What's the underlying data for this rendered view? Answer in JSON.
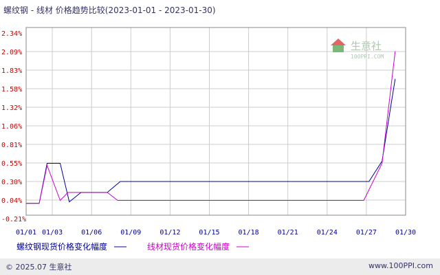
{
  "header": {
    "title": "螺纹钢 - 线材 价格趋势比较(2023-01-01 - 2023-01-30)"
  },
  "watermark": {
    "text": "生意社",
    "sub": "100PPI.COM"
  },
  "footer": {
    "copyright": "© 2025.07 生意社",
    "site": "www.100PPI.com"
  },
  "colors": {
    "series1": "#000099",
    "series2": "#cc00cc",
    "ytick": "#cc0000",
    "xtick": "#000099",
    "grid": "#cccccc"
  },
  "chart_data": {
    "type": "line",
    "title": "螺纹钢 - 线材 价格趋势比较(2023-01-01 - 2023-01-30)",
    "xlabel": "",
    "ylabel": "",
    "x_ticks": [
      "01/01",
      "01/03",
      "01/06",
      "01/09",
      "01/12",
      "01/15",
      "01/18",
      "01/21",
      "01/24",
      "01/27",
      "01/30"
    ],
    "x_tick_days": [
      1,
      3,
      6,
      9,
      12,
      15,
      18,
      21,
      24,
      27,
      30
    ],
    "y_ticks": [
      "2.34%",
      "2.09%",
      "1.83%",
      "1.58%",
      "1.32%",
      "1.06%",
      "0.81%",
      "0.55%",
      "0.30%",
      "0.04%",
      "-0.21%"
    ],
    "ylim": [
      -0.21,
      2.34
    ],
    "xlim": [
      1,
      30
    ],
    "grid": true,
    "legend_position": "bottom",
    "series": [
      {
        "name": "螺纹钢现货价格变化幅度",
        "color": "#000099",
        "points": [
          [
            1,
            0
          ],
          [
            2,
            0
          ],
          [
            2.6,
            0.55
          ],
          [
            3.6,
            0.55
          ],
          [
            4.3,
            0.02
          ],
          [
            5.2,
            0.15
          ],
          [
            7.2,
            0.15
          ],
          [
            8.2,
            0.3
          ],
          [
            27.2,
            0.3
          ],
          [
            28.2,
            0.58
          ],
          [
            29.2,
            1.71
          ]
        ]
      },
      {
        "name": "线材现货价格变化幅度",
        "color": "#cc00cc",
        "points": [
          [
            1,
            0
          ],
          [
            2,
            0
          ],
          [
            2.6,
            0.52
          ],
          [
            3.6,
            0.04
          ],
          [
            4.2,
            0.15
          ],
          [
            7.2,
            0.15
          ],
          [
            8,
            0.04
          ],
          [
            26.2,
            0.04
          ],
          [
            26.8,
            0.04
          ],
          [
            28.2,
            0.55
          ],
          [
            29.2,
            2.09
          ]
        ]
      }
    ]
  }
}
